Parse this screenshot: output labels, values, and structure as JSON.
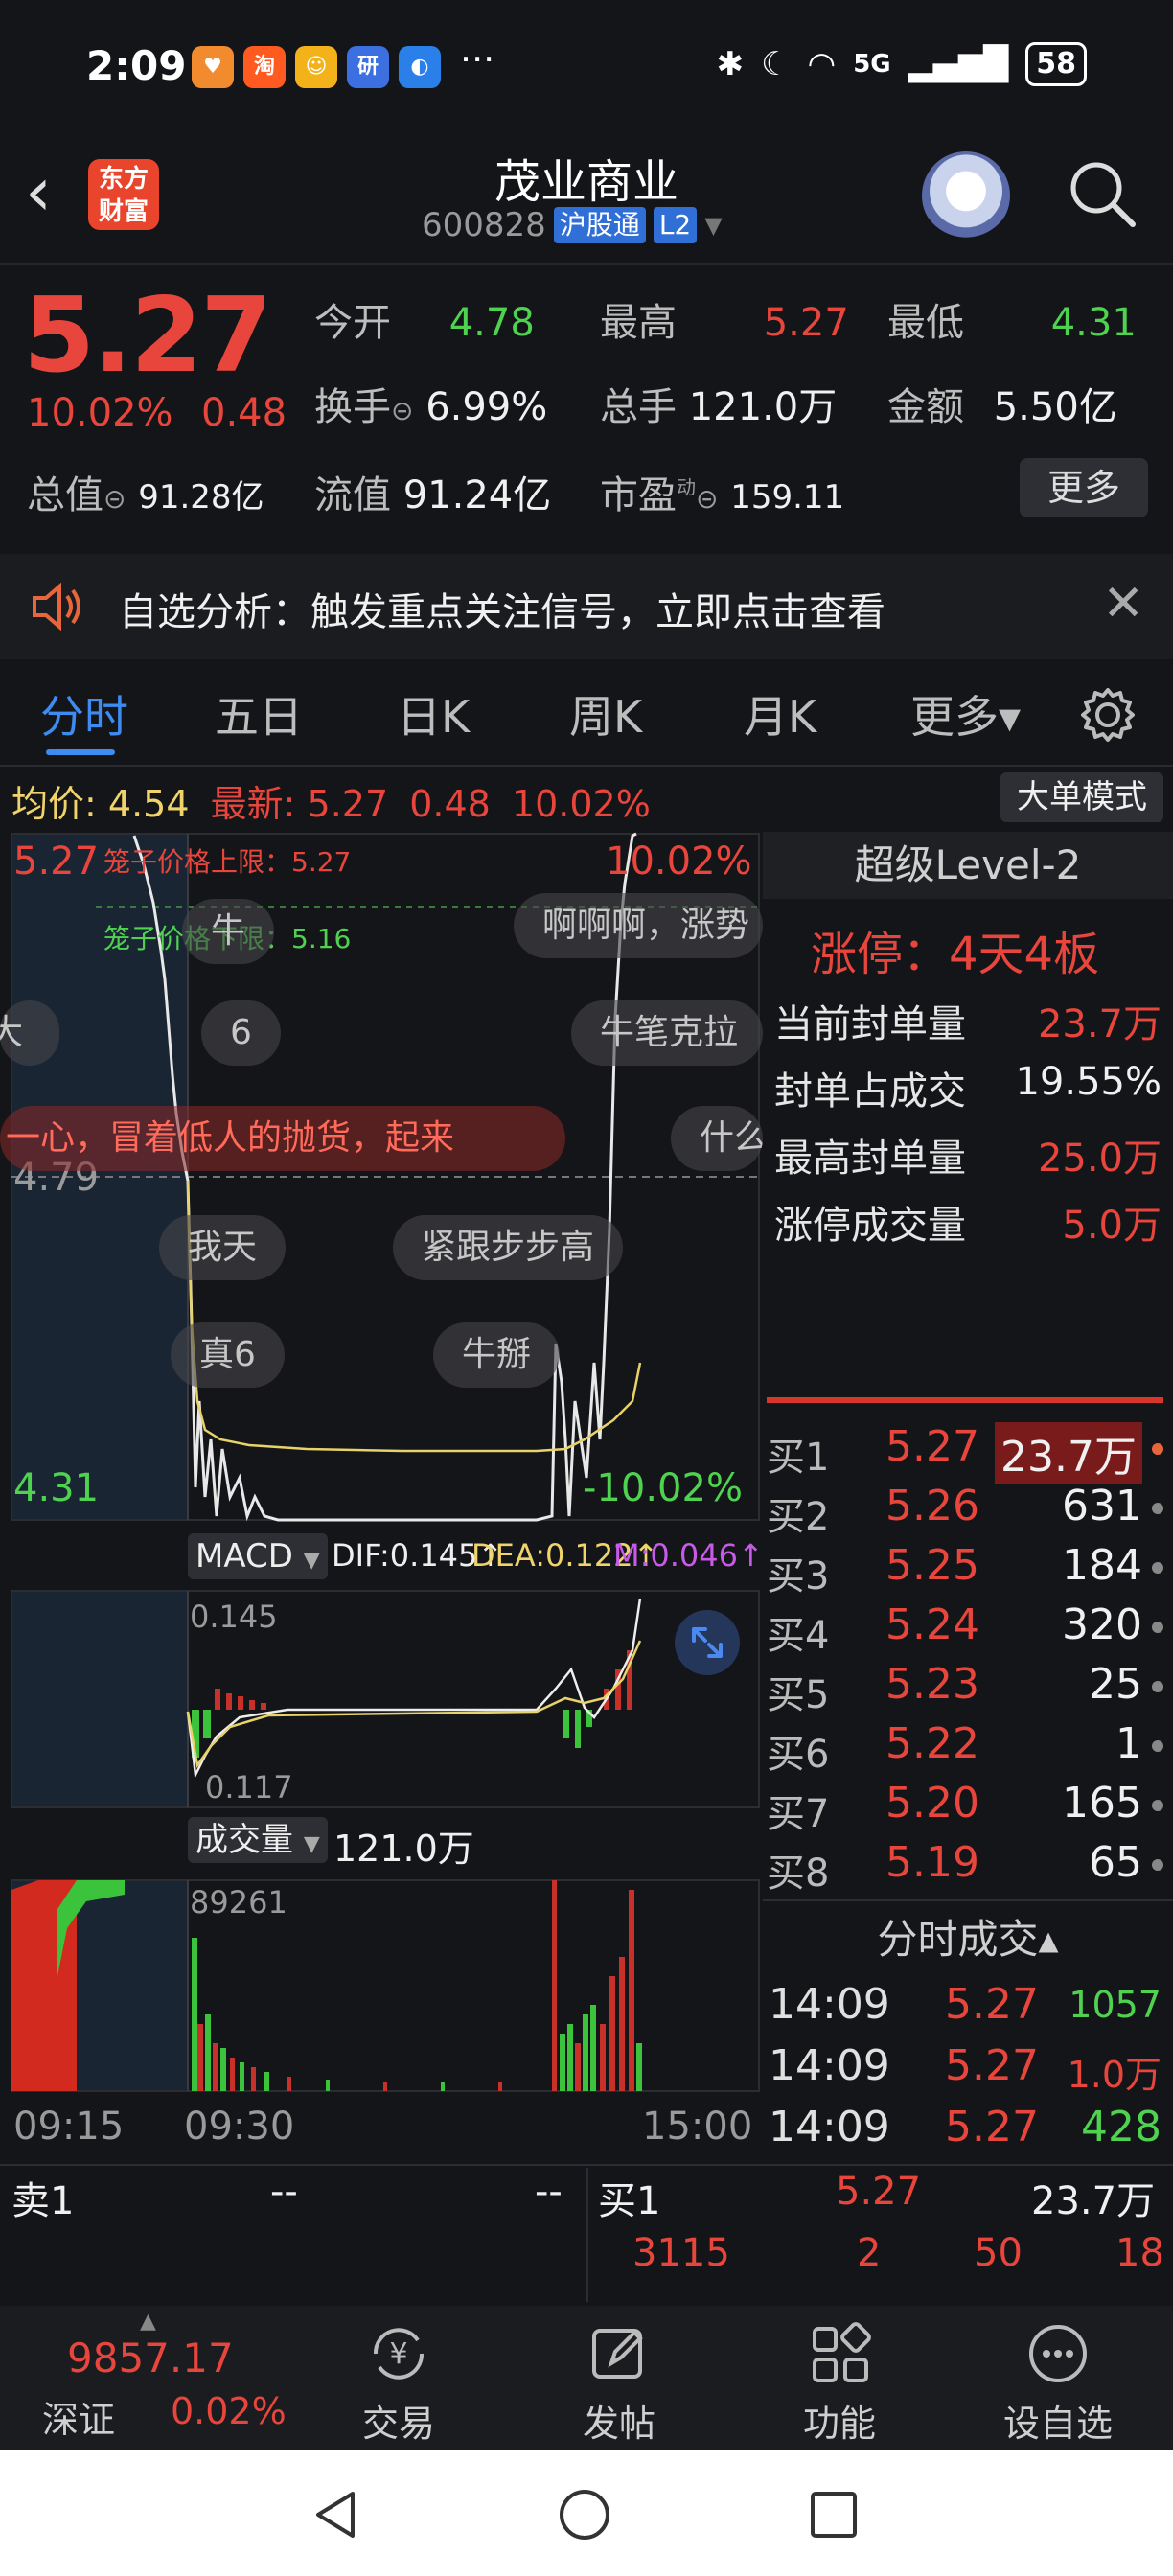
{
  "status": {
    "time": "2:09",
    "network": "5G",
    "battery": "58",
    "more": "···"
  },
  "header": {
    "title": "茂业商业",
    "code": "600828",
    "tag": "沪股通",
    "level": "L2",
    "logo_line1": "东方",
    "logo_line2": "财富"
  },
  "quote": {
    "price": "5.27",
    "pct": "10.02%",
    "change": "0.48",
    "open_label": "今开",
    "open": "4.78",
    "high_label": "最高",
    "high": "5.27",
    "low_label": "最低",
    "low": "4.31",
    "turnover_label": "换手",
    "turnover": "6.99%",
    "volume_label": "总手",
    "volume": "121.0万",
    "amount_label": "金额",
    "amount": "5.50亿",
    "mktcap_label": "总值",
    "mktcap": "91.28亿",
    "float_label": "流值",
    "float": "91.24亿",
    "pe_label": "市盈",
    "pe_sup": "动",
    "pe": "159.11",
    "more": "更多"
  },
  "notice": {
    "text": "自选分析：触发重点关注信号，立即点击查看",
    "close": "✕"
  },
  "tabs": [
    {
      "label": "分时"
    },
    {
      "label": "五日"
    },
    {
      "label": "日K"
    },
    {
      "label": "周K"
    },
    {
      "label": "月K"
    },
    {
      "label": "更多▾"
    }
  ],
  "intraday": {
    "avg_label": "均价:",
    "avg": "4.54",
    "latest_label": "最新:",
    "latest": "5.27",
    "latest_chg": "0.48",
    "latest_pct": "10.02%",
    "mode_button": "大单模式",
    "axis_top": "5.27",
    "axis_mid": "4.79",
    "axis_bot": "4.31",
    "pct_top": "10.02%",
    "pct_bot": "-10.02%",
    "cage_upper": "笼子价格上限：5.27",
    "cage_lower": "笼子价格下限：5.16",
    "time_labels": [
      "09:15",
      "09:30",
      "15:00"
    ]
  },
  "danmaku": [
    "牛",
    "啊啊啊，涨势",
    "6",
    "牛笔克拉",
    "一心，冒着低人的抛货，起来",
    "什么",
    "我天",
    "紧跟步步高",
    "真6",
    "牛掰",
    "大"
  ],
  "macd": {
    "label": "MACD",
    "dif": "DIF:0.145↑",
    "dea": "DEA:0.122↑",
    "m": "M:0.046↑",
    "top": "0.145",
    "bot": "0.117"
  },
  "vol": {
    "label": "成交量",
    "value": "121.0万",
    "max": "89261"
  },
  "level2": {
    "title": "超级Level-2",
    "limit_up": "涨停：4天4板",
    "rows": [
      {
        "label": "当前封单量",
        "value": "23.7万",
        "color": "#e8453c"
      },
      {
        "label": "封单占成交",
        "value": "19.55%",
        "color": "#e6e6e6"
      },
      {
        "label": "最高封单量",
        "value": "25.0万",
        "color": "#e8453c"
      },
      {
        "label": "涨停成交量",
        "value": "5.0万",
        "color": "#e8453c"
      }
    ]
  },
  "orderbook": [
    {
      "label": "买1",
      "price": "5.27",
      "qty": "23.7万"
    },
    {
      "label": "买2",
      "price": "5.26",
      "qty": "631"
    },
    {
      "label": "买3",
      "price": "5.25",
      "qty": "184"
    },
    {
      "label": "买4",
      "price": "5.24",
      "qty": "320"
    },
    {
      "label": "买5",
      "price": "5.23",
      "qty": "25"
    },
    {
      "label": "买6",
      "price": "5.22",
      "qty": "1"
    },
    {
      "label": "买7",
      "price": "5.20",
      "qty": "165"
    },
    {
      "label": "买8",
      "price": "5.19",
      "qty": "65"
    }
  ],
  "ticks": {
    "title": "分时成交▴",
    "rows": [
      {
        "time": "14:09",
        "price": "5.27",
        "vol": "1057",
        "color": "#4fd24f"
      },
      {
        "time": "14:09",
        "price": "5.27",
        "vol": "1.0万",
        "color": "#e8453c"
      },
      {
        "time": "14:09",
        "price": "5.27",
        "vol": "428",
        "color": "#4fd24f"
      }
    ]
  },
  "strip": {
    "sell1": "卖1",
    "sell_p": "--",
    "sell_q": "--",
    "buy1": "买1",
    "buy_p": "5.27",
    "buy_q": "23.7万",
    "row2": [
      "3115",
      "2",
      "50",
      "18"
    ]
  },
  "bottom_nav": {
    "index_value": "9857.17",
    "index_name": "深证",
    "index_pct": "0.02%",
    "items": [
      {
        "label": "交易"
      },
      {
        "label": "发帖"
      },
      {
        "label": "功能"
      },
      {
        "label": "设自选"
      }
    ]
  }
}
